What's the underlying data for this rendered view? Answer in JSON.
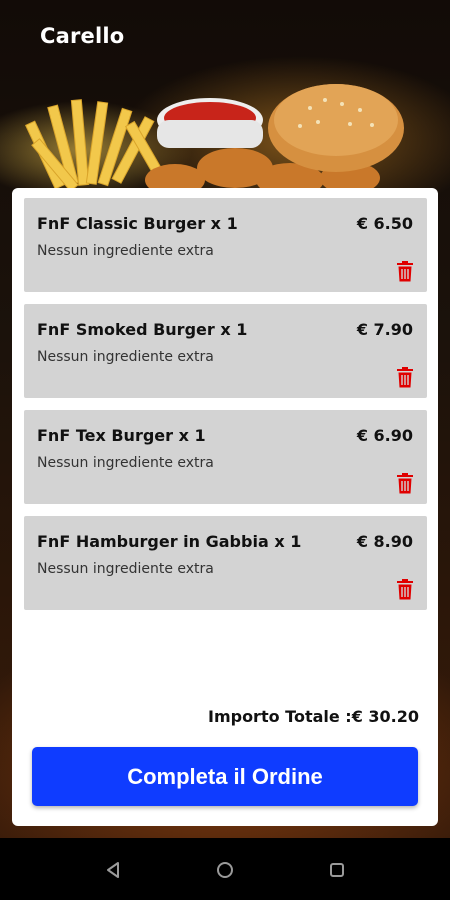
{
  "header": {
    "title": "Carello"
  },
  "cart": {
    "items": [
      {
        "name": "FnF Classic Burger x 1",
        "price": "€ 6.50",
        "extras": "Nessun ingrediente extra"
      },
      {
        "name": "FnF Smoked Burger x 1",
        "price": "€ 7.90",
        "extras": "Nessun ingrediente extra"
      },
      {
        "name": "FnF Tex Burger x 1",
        "price": "€ 6.90",
        "extras": "Nessun ingrediente extra"
      },
      {
        "name": "FnF Hamburger in Gabbia x 1",
        "price": "€ 8.90",
        "extras": "Nessun ingrediente extra"
      }
    ],
    "total_label": "Importo Totale :€ 30.20",
    "checkout_label": "Completa il Ordine"
  },
  "icons": {
    "delete": "trash-icon",
    "back": "back-icon",
    "home": "home-icon",
    "recents": "recents-icon"
  },
  "colors": {
    "accent": "#0f3cff",
    "delete": "#e00000",
    "item_bg": "#d3d3d3"
  }
}
